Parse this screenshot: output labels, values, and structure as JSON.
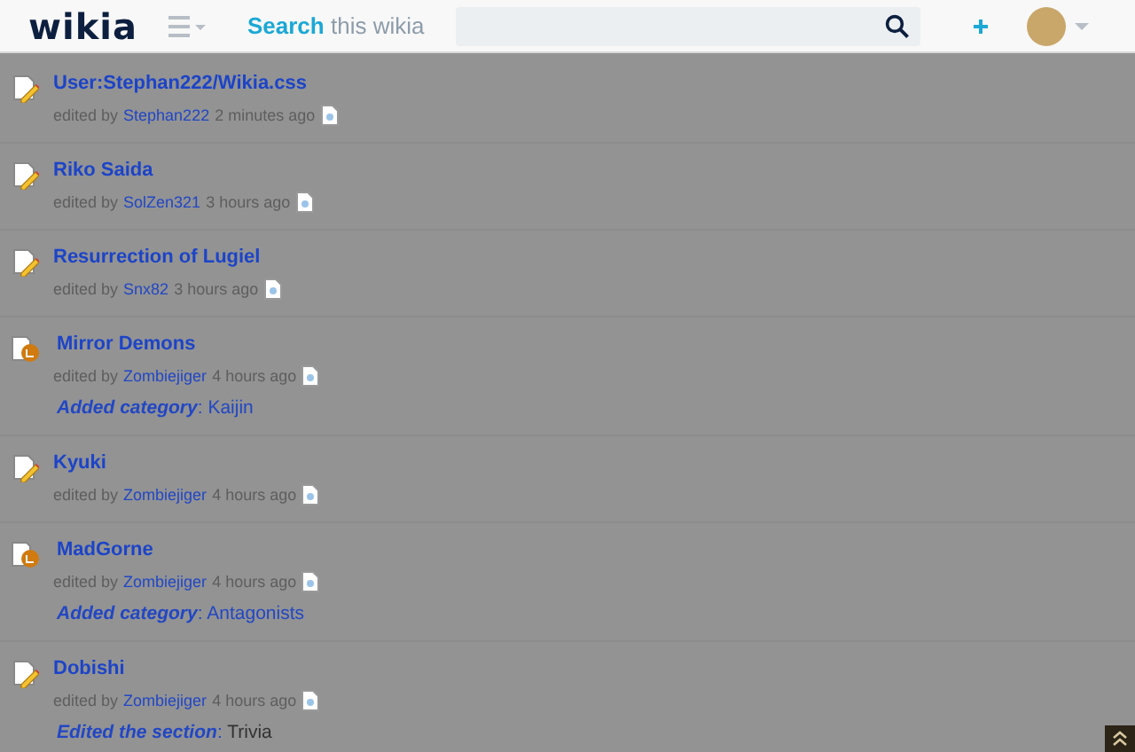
{
  "header": {
    "logo": "wikia",
    "search": {
      "label_bold": "Search",
      "label_rest": "this wikia"
    }
  },
  "activity": [
    {
      "kind": "edit",
      "title": "User:Stephan222/Wikia.css",
      "prefix": "edited by",
      "user": "Stephan222",
      "time": "2 minutes ago"
    },
    {
      "kind": "edit",
      "title": "Riko Saida",
      "prefix": "edited by",
      "user": "SolZen321",
      "time": "3 hours ago"
    },
    {
      "kind": "edit",
      "title": "Resurrection of Lugiel",
      "prefix": "edited by",
      "user": "Snx82",
      "time": "3 hours ago"
    },
    {
      "kind": "category",
      "title": "Mirror Demons",
      "prefix": "edited by",
      "user": "Zombiejiger",
      "time": "4 hours ago",
      "detail": {
        "label": "Added category",
        "separator": ":",
        "value": "Kaijin",
        "value_is_link": true
      }
    },
    {
      "kind": "edit",
      "title": "Kyuki",
      "prefix": "edited by",
      "user": "Zombiejiger",
      "time": "4 hours ago"
    },
    {
      "kind": "category",
      "title": "MadGorne",
      "prefix": "edited by",
      "user": "Zombiejiger",
      "time": "4 hours ago",
      "detail": {
        "label": "Added category",
        "separator": ":",
        "value": "Antagonists",
        "value_is_link": true
      }
    },
    {
      "kind": "edit",
      "title": "Dobishi",
      "prefix": "edited by",
      "user": "Zombiejiger",
      "time": "4 hours ago",
      "detail": {
        "label": "Edited the section",
        "separator": ":",
        "value": "Trivia",
        "value_is_link": false
      }
    }
  ]
}
